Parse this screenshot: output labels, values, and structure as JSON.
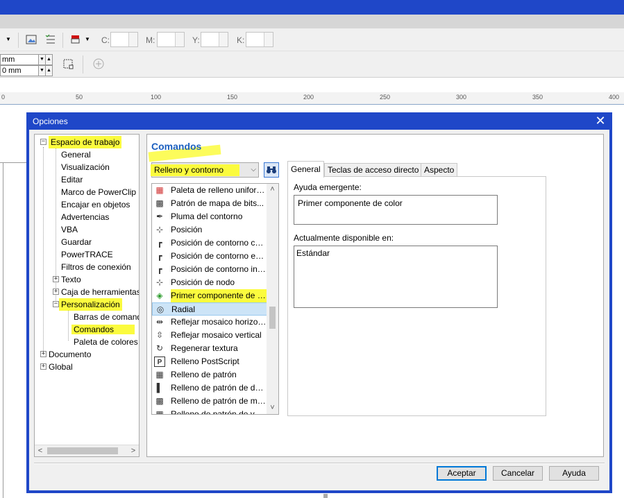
{
  "toolbar": {
    "cmyk_labels": [
      "C:",
      "M:",
      "Y:",
      "K:"
    ],
    "mm_fields": [
      "mm",
      "0 mm"
    ]
  },
  "ruler": {
    "labels": [
      "0",
      "50",
      "100",
      "150",
      "200",
      "250",
      "300",
      "350",
      "400"
    ]
  },
  "dialog": {
    "title": "Opciones",
    "close_label": "✕"
  },
  "tree": {
    "items": [
      {
        "label": "Espacio de trabajo",
        "level": 0,
        "expander": "−",
        "highlight": true
      },
      {
        "label": "General",
        "level": 1
      },
      {
        "label": "Visualización",
        "level": 1
      },
      {
        "label": "Editar",
        "level": 1
      },
      {
        "label": "Marco de PowerClip",
        "level": 1
      },
      {
        "label": "Encajar en objetos",
        "level": 1
      },
      {
        "label": "Advertencias",
        "level": 1
      },
      {
        "label": "VBA",
        "level": 1
      },
      {
        "label": "Guardar",
        "level": 1
      },
      {
        "label": "PowerTRACE",
        "level": 1
      },
      {
        "label": "Filtros de conexión",
        "level": 1
      },
      {
        "label": "Texto",
        "level": 1,
        "expander": "+"
      },
      {
        "label": "Caja de herramientas",
        "level": 1,
        "expander": "+"
      },
      {
        "label": "Personalización",
        "level": 1,
        "expander": "−",
        "highlight": true
      },
      {
        "label": "Barras de comandos",
        "level": 2
      },
      {
        "label": "Comandos",
        "level": 2,
        "highlight": true
      },
      {
        "label": "Paleta de colores",
        "level": 2
      },
      {
        "label": "Documento",
        "level": 0,
        "expander": "+"
      },
      {
        "label": "Global",
        "level": 0,
        "expander": "+"
      }
    ],
    "scroll_left": "<",
    "scroll_right": ">"
  },
  "panel": {
    "title": "Comandos",
    "category_selected": "Relleno y contorno",
    "commands": [
      {
        "label": "Paleta de relleno uniforme",
        "icon": "palette-icon",
        "glyph": "▦"
      },
      {
        "label": "Patrón de mapa de bits...",
        "icon": "bitmap-pattern-icon",
        "glyph": "▩"
      },
      {
        "label": "Pluma del contorno",
        "icon": "pen-nib-icon",
        "glyph": "✒"
      },
      {
        "label": "Posición",
        "icon": "position-icon",
        "glyph": "⊹"
      },
      {
        "label": "Posición de contorno centrado",
        "icon": "outline-center-icon",
        "glyph": "┏"
      },
      {
        "label": "Posición de contorno exterior",
        "icon": "outline-outside-icon",
        "glyph": "┏"
      },
      {
        "label": "Posición de contorno interior",
        "icon": "outline-inside-icon",
        "glyph": "┏"
      },
      {
        "label": "Posición de nodo",
        "icon": "node-position-icon",
        "glyph": "⊹"
      },
      {
        "label": "Primer componente de color",
        "icon": "color-component-icon",
        "glyph": "◈",
        "highlight": true
      },
      {
        "label": "Radial",
        "icon": "radial-icon",
        "glyph": "◎",
        "selected": true
      },
      {
        "label": "Reflejar mosaico horizontal",
        "icon": "mirror-h-icon",
        "glyph": "⇹"
      },
      {
        "label": "Reflejar mosaico vertical",
        "icon": "mirror-v-icon",
        "glyph": "⇳"
      },
      {
        "label": "Regenerar textura",
        "icon": "regenerate-icon",
        "glyph": "↻"
      },
      {
        "label": "Relleno PostScript",
        "icon": "postscript-icon",
        "glyph": "P"
      },
      {
        "label": "Relleno de patrón",
        "icon": "pattern-fill-icon",
        "glyph": "▦"
      },
      {
        "label": "Relleno de patrón de dos colores",
        "icon": "two-color-pattern-icon",
        "glyph": "▌"
      },
      {
        "label": "Relleno de patrón de mapa de bits",
        "icon": "bitmap-fill-icon",
        "glyph": "▩"
      },
      {
        "label": "Relleno de patrón de vectores",
        "icon": "vector-fill-icon",
        "glyph": "▦"
      }
    ],
    "scroll_up": "˄",
    "scroll_down": "˅",
    "tabs": [
      "General",
      "Teclas de acceso directo",
      "Aspecto"
    ],
    "tooltip_label": "Ayuda emergente:",
    "tooltip_value": "Primer componente de color",
    "available_label": "Actualmente disponible en:",
    "available_value": "Estándar"
  },
  "buttons": {
    "accept": "Aceptar",
    "cancel": "Cancelar",
    "help": "Ayuda"
  }
}
